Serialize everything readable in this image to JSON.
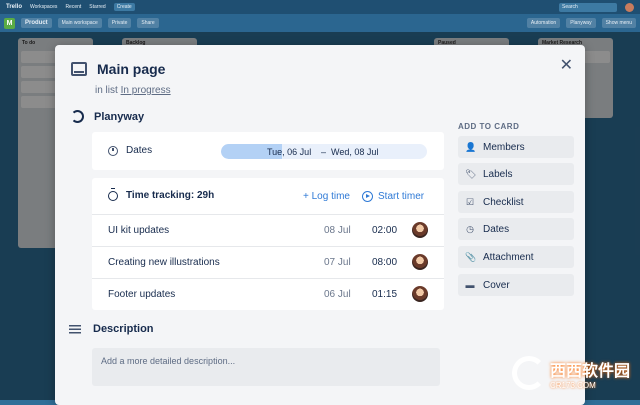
{
  "topbar": {
    "app_name": "Trello",
    "menus": [
      "Workspaces",
      "Recent",
      "Starred"
    ],
    "create_label": "Create",
    "search_placeholder": "Search"
  },
  "boardbar": {
    "workspace_badge": "M",
    "board_name": "Product",
    "view_chip": "Main workspace",
    "visibility_chip": "Private",
    "share_chip": "Share",
    "automation_chip": "Automation",
    "planyway_chip": "Planyway",
    "show_menu_chip": "Show menu"
  },
  "background_lists": [
    {
      "title": "To do"
    },
    {
      "title": "Backlog"
    },
    {
      "title": "Paused"
    },
    {
      "title": "Market Research"
    }
  ],
  "card": {
    "title": "Main page",
    "list_prefix": "in list",
    "list_name": "In progress",
    "close_icon": "close-icon"
  },
  "planyway": {
    "title": "Planyway",
    "dates_label": "Dates",
    "start_date": "Tue, 06 Jul",
    "dash": "–",
    "end_date": "Wed, 08 Jul",
    "tracking_label": "Time tracking: 29h",
    "log_time": "+ Log time",
    "start_timer": "Start timer",
    "entries": [
      {
        "name": "UI kit updates",
        "date": "08 Jul",
        "time": "02:00"
      },
      {
        "name": "Creating new illustrations",
        "date": "07 Jul",
        "time": "08:00"
      },
      {
        "name": "Footer updates",
        "date": "06 Jul",
        "time": "01:15"
      }
    ]
  },
  "description": {
    "title": "Description",
    "placeholder": "Add a more detailed description..."
  },
  "sidebar": {
    "label": "ADD TO CARD",
    "buttons": [
      {
        "label": "Members",
        "icon": "person-icon",
        "glyph": "👤"
      },
      {
        "label": "Labels",
        "icon": "tag-icon",
        "glyph": "🏷"
      },
      {
        "label": "Checklist",
        "icon": "checkbox-icon",
        "glyph": "☑"
      },
      {
        "label": "Dates",
        "icon": "clock-icon",
        "glyph": "◷"
      },
      {
        "label": "Attachment",
        "icon": "paperclip-icon",
        "glyph": "📎"
      },
      {
        "label": "Cover",
        "icon": "cover-icon",
        "glyph": "▬"
      }
    ]
  },
  "watermark": {
    "text": "西西软件园",
    "sub": "CR173.COM"
  }
}
